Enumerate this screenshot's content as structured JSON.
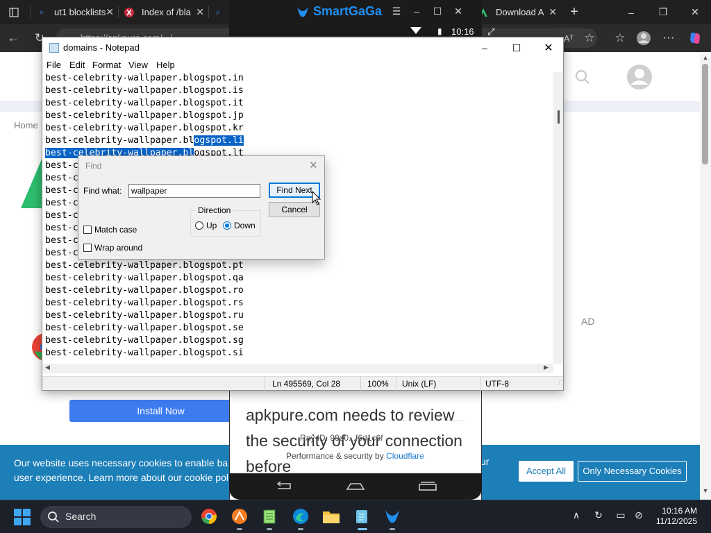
{
  "browser": {
    "tabs": [
      {
        "label": "ut1 blocklists"
      },
      {
        "label": "Index of /bla"
      },
      {
        "label": ""
      },
      {
        "label": "Download A"
      }
    ],
    "url_text": "https://apkpure.com/.../...",
    "reader_label": "Aᵀ"
  },
  "smartgaga": {
    "brand": "SmartGaGa",
    "status_time": "10:16"
  },
  "webpage": {
    "breadcrumb": "Home",
    "ad_label": "AD",
    "install_button": "Install Now",
    "cookie_text_left": "Our website uses necessary cookies to enable ba user experience. Learn more about our cookie pol",
    "cookie_text_right": "ur",
    "accept_all": "Accept All",
    "only_necessary": "Only Necessary Cookies"
  },
  "phone": {
    "headline": "apkpure.com needs to review the security of your connection before",
    "ray_id": "Ray ID: 99d0...f6d1c6f",
    "perf_prefix": "Performance & security by ",
    "perf_link": "Cloudflare"
  },
  "notepad": {
    "title": "domains - Notepad",
    "menu": [
      "File",
      "Edit",
      "Format",
      "View",
      "Help"
    ],
    "lines": [
      "best-celebrity-wallpaper.blogspot.in",
      "best-celebrity-wallpaper.blogspot.is",
      "best-celebrity-wallpaper.blogspot.it",
      "best-celebrity-wallpaper.blogspot.jp",
      "best-celebrity-wallpaper.blogspot.kr",
      "best-celebrity-wallpaper.blogspot.li",
      "best-celebrity-wallpaper.blogspot.lt",
      "best-c",
      "best-c",
      "best-c",
      "best-c",
      "best-c",
      "best-c",
      "best-c",
      "best-c",
      "best-celebrity-wallpaper.blogspot.pt",
      "best-celebrity-wallpaper.blogspot.qa",
      "best-celebrity-wallpaper.blogspot.ro",
      "best-celebrity-wallpaper.blogspot.rs",
      "best-celebrity-wallpaper.blogspot.ru",
      "best-celebrity-wallpaper.blogspot.se",
      "best-celebrity-wallpaper.blogspot.sg",
      "best-celebrity-wallpaper.blogspot.si"
    ],
    "status": {
      "position": "Ln 495569, Col 28",
      "zoom": "100%",
      "line_ending": "Unix (LF)",
      "encoding": "UTF-8"
    }
  },
  "find_dialog": {
    "title": "Find",
    "find_what_label": "Find what:",
    "find_what_value": "wallpaper",
    "find_next": "Find Next",
    "cancel": "Cancel",
    "direction_label": "Direction",
    "up_label": "Up",
    "down_label": "Down",
    "direction_selected": "Down",
    "match_case_label": "Match case",
    "match_case_checked": false,
    "wrap_around_label": "Wrap around",
    "wrap_around_checked": false
  },
  "taskbar": {
    "search_label": "Search",
    "time": "10:16 AM",
    "date": "11/12/2025"
  },
  "colors": {
    "selection": "#0a64c8",
    "cookie_bar": "#1d7fb8",
    "install_button": "#3d7bf0",
    "smartgaga_blue": "#1f8ff0"
  }
}
